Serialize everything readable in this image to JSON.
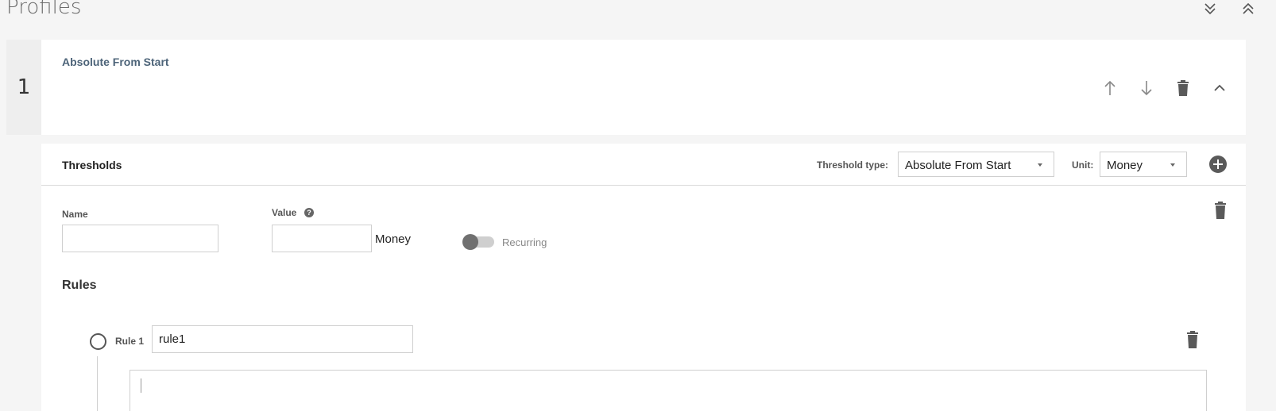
{
  "page": {
    "title": "Profiles",
    "expand_all_icon": "double-chevron-down-icon",
    "collapse_all_icon": "double-chevron-up-icon"
  },
  "profile": {
    "index": "1",
    "name": "Absolute From Start",
    "actions": [
      "arrow-up-icon",
      "arrow-down-icon",
      "trash-icon",
      "chevron-up-icon"
    ]
  },
  "thresholds": {
    "title": "Thresholds",
    "threshold_type_label": "Threshold type:",
    "threshold_type_value": "Absolute From Start",
    "unit_label": "Unit:",
    "unit_value": "Money",
    "add_icon": "plus-circle-icon",
    "item": {
      "name_label": "Name",
      "name_value": "",
      "value_label": "Value",
      "value_value": "",
      "value_suffix": "Money",
      "help_glyph": "?",
      "recurring_label": "Recurring",
      "recurring_on": false
    },
    "rules": {
      "title": "Rules",
      "items": [
        {
          "label": "Rule 1",
          "value": "rule1",
          "expression": ""
        }
      ]
    }
  },
  "colors": {
    "background": "#f5f5f5",
    "card": "#ffffff",
    "profile_name": "#4d6479",
    "icon": "#5a5a5a"
  }
}
